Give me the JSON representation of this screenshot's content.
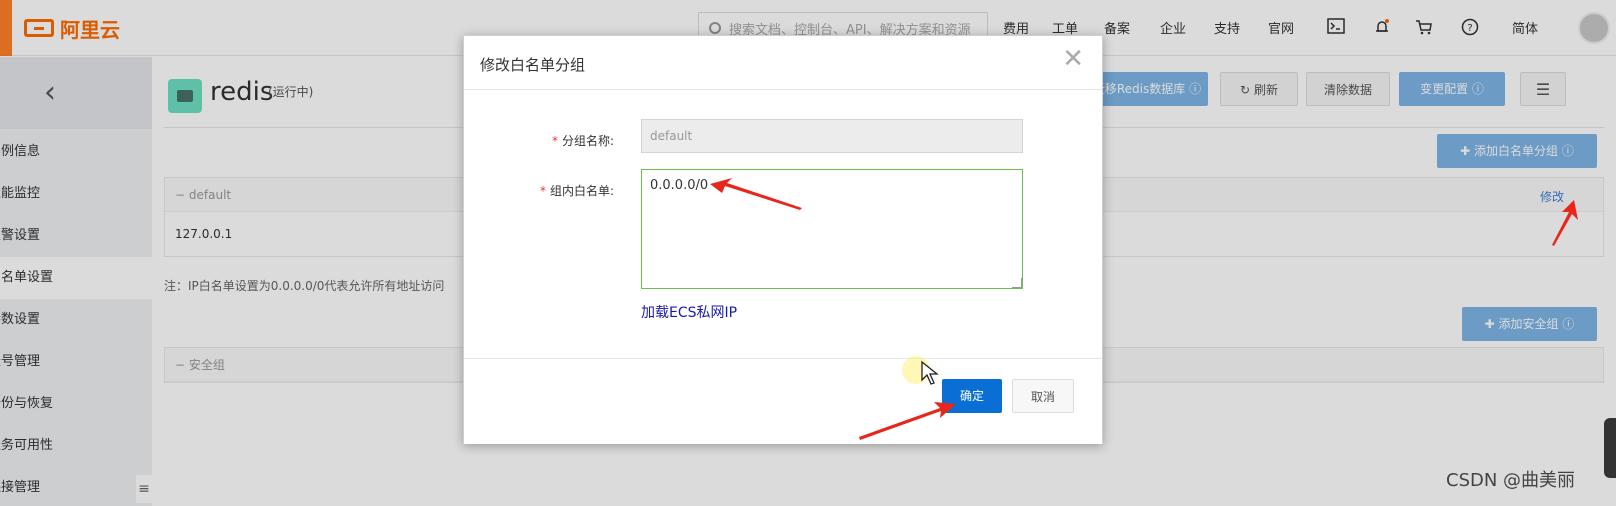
{
  "topbar": {
    "logo_text": "阿里云",
    "search_placeholder": "搜索文档、控制台、API、解决方案和资源",
    "nav": [
      "费用",
      "工单",
      "备案",
      "企业",
      "支持",
      "官网"
    ],
    "lang": "简体",
    "icons": [
      "terminal-icon",
      "bell-icon",
      "cart-icon",
      "help-icon"
    ],
    "brand_color": "#ff6a00"
  },
  "sidebar": {
    "back_icon": "chevron-left-icon",
    "items": [
      {
        "label": "实例信息",
        "active": false
      },
      {
        "label": "性能监控",
        "active": false
      },
      {
        "label": "报警设置",
        "active": false
      },
      {
        "label": "白名单设置",
        "active": true
      },
      {
        "label": "参数设置",
        "active": false
      },
      {
        "label": "账号管理",
        "active": false
      },
      {
        "label": "备份与恢复",
        "active": false
      },
      {
        "label": "服务可用性",
        "active": false
      },
      {
        "label": "连接管理",
        "active": false
      }
    ]
  },
  "main": {
    "title": "redis",
    "status": "(运行中)",
    "toolbar": {
      "migrate_label": "迁移Redis数据库",
      "refresh_label": "刷新",
      "clear_label": "清除数据",
      "change_config_label": "变更配置"
    },
    "add_whitelist_group_label": "添加白名单分组",
    "whitelist_group": {
      "name": "default",
      "ips": "127.0.0.1",
      "edit_label": "修改"
    },
    "note": "注：IP白名单设置为0.0.0.0/0代表允许所有地址访问",
    "add_security_group_label": "添加安全组",
    "security_group_header": "安全组"
  },
  "dialog": {
    "title": "修改白名单分组",
    "group_name_label": "分组名称:",
    "group_name_value": "default",
    "whitelist_label": "组内白名单:",
    "whitelist_value": "0.0.0.0/0",
    "load_ecs_label": "加载ECS私网IP",
    "confirm_label": "确定",
    "cancel_label": "取消"
  },
  "watermark": "CSDN @曲美丽",
  "annotation_color": "#e8261c"
}
